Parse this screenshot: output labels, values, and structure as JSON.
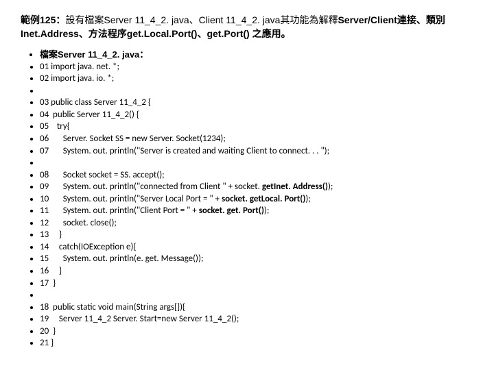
{
  "title": {
    "p1": "範例125：",
    "p2": "設有檔案Server 11_4_2. java、Client 11_4_2. java其功能為解釋",
    "p3": "Server/Client連接、類別Inet.Address、方法程序get.Local.Port()、get.Port() 之應用。"
  },
  "header": "檔案Server 11_4_2. java：",
  "lines": {
    "l01": "01 import java. net. *;",
    "l02": "02 import java. io. *;",
    "l03": "",
    "l04": "03 public class Server 11_4_2 {",
    "l05": "04  public Server 11_4_2() {",
    "l06": "05    try{",
    "l07": "06       Server. Socket SS = new Server. Socket(1234);",
    "l08": "07       System. out. println(\"Server is created and waiting Client to connect. . . \");",
    "l09": "",
    "l10": "08       Socket socket = SS. accept();",
    "l11a": "09       System. out. println(\"connected from Client \" + socket. ",
    "l11b": "getInet. Address()",
    "l11c": ");",
    "l12a": "10       System. out. println(\"Server Local Port = \" + ",
    "l12b": "socket. getLocal. Port()",
    "l12c": ");",
    "l13a": "11       System. out. println(\"Client Port = \" + ",
    "l13b": "socket. get. Port()",
    "l13c": ");",
    "l14": "12       socket. close();",
    "l15": "13     }",
    "l16": "14     catch(IOException e){",
    "l17": "15       System. out. println(e. get. Message());",
    "l18": "16     }",
    "l19": "17  }",
    "l20": "",
    "l21": "18  public static void main(String args[]){",
    "l22": "19     Server 11_4_2 Server. Start=new Server 11_4_2();",
    "l23": "20  }",
    "l24": "21 }"
  }
}
